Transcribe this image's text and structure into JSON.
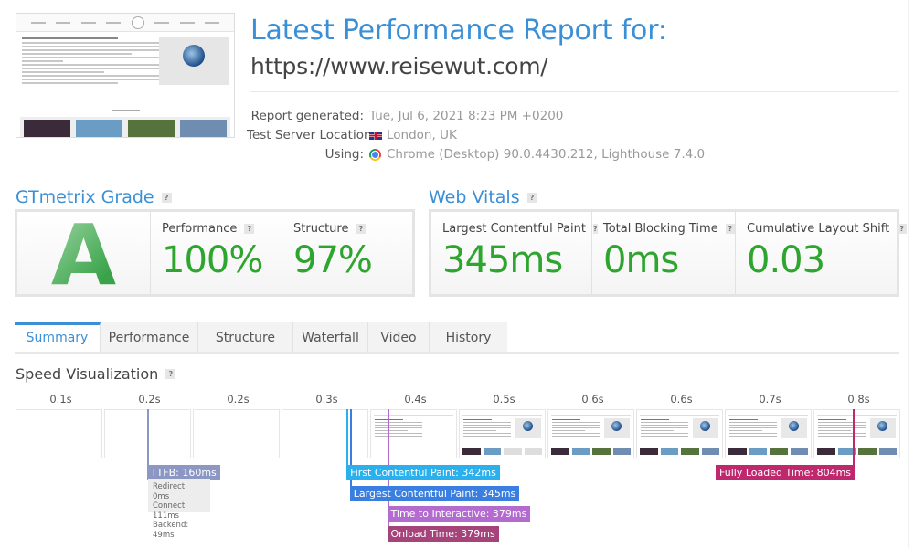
{
  "header": {
    "title": "Latest Performance Report for:",
    "url": "https://www.reisewut.com/"
  },
  "meta": [
    {
      "label": "Report generated:",
      "value": "Tue, Jul 6, 2021 8:23 PM +0200",
      "icon": ""
    },
    {
      "label": "Test Server Location:",
      "value": "London, UK",
      "icon": "uk-flag-icon"
    },
    {
      "label": "Using:",
      "value": "Chrome (Desktop) 90.0.4430.212, Lighthouse 7.4.0",
      "icon": "chrome-icon"
    }
  ],
  "gtmetrix": {
    "heading": "GTmetrix Grade",
    "grade": "A",
    "performance_label": "Performance",
    "performance_value": "100%",
    "structure_label": "Structure",
    "structure_value": "97%"
  },
  "web_vitals": {
    "heading": "Web Vitals",
    "items": [
      {
        "label": "Largest Contentful Paint",
        "value": "345ms"
      },
      {
        "label": "Total Blocking Time",
        "value": "0ms"
      },
      {
        "label": "Cumulative Layout Shift",
        "value": "0.03"
      }
    ]
  },
  "help_glyph": "?",
  "tabs": [
    {
      "label": "Summary",
      "active": true
    },
    {
      "label": "Performance",
      "active": false
    },
    {
      "label": "Structure",
      "active": false
    },
    {
      "label": "Waterfall",
      "active": false
    },
    {
      "label": "Video",
      "active": false
    },
    {
      "label": "History",
      "active": false
    }
  ],
  "speed_visualization": {
    "heading": "Speed Visualization",
    "frame_labels": [
      "0.1s",
      "0.2s",
      "0.2s",
      "0.3s",
      "0.4s",
      "0.5s",
      "0.6s",
      "0.6s",
      "0.7s",
      "0.8s"
    ],
    "frame_rendered": [
      false,
      false,
      false,
      false,
      true,
      true,
      true,
      true,
      true,
      true
    ],
    "markers": {
      "ttfb": {
        "label": "TTFB: 160ms",
        "ms": 160,
        "color": "#8c97c4"
      },
      "ttfb_breakdown": [
        "Redirect: 0ms",
        "Connect: 111ms",
        "Backend: 49ms"
      ],
      "fcp": {
        "label": "First Contentful Paint: 342ms",
        "ms": 342,
        "color": "#2ab0ec"
      },
      "lcp": {
        "label": "Largest Contentful Paint: 345ms",
        "ms": 345,
        "color": "#3a7fe0"
      },
      "tti": {
        "label": "Time to Interactive: 379ms",
        "ms": 379,
        "color": "#b36bd0"
      },
      "onload": {
        "label": "Onload Time: 379ms",
        "ms": 379,
        "color": "#a5437a"
      },
      "fully_loaded": {
        "label": "Fully Loaded Time: 804ms",
        "ms": 804,
        "color": "#c0286e"
      }
    }
  }
}
